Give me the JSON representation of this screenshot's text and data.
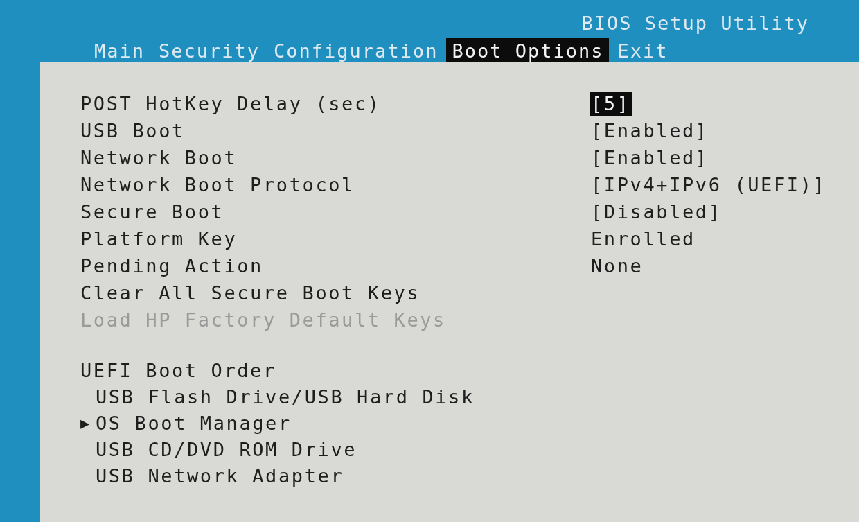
{
  "title": "BIOS Setup Utility",
  "tabs": [
    {
      "label": "Main",
      "selected": false
    },
    {
      "label": "Security",
      "selected": false
    },
    {
      "label": "Configuration",
      "selected": false
    },
    {
      "label": "Boot Options",
      "selected": true
    },
    {
      "label": "Exit",
      "selected": false
    }
  ],
  "settings": [
    {
      "label": "POST HotKey Delay (sec)",
      "value": "[5]",
      "selected": true,
      "disabled": false
    },
    {
      "label": "USB Boot",
      "value": "[Enabled]",
      "selected": false,
      "disabled": false
    },
    {
      "label": "Network Boot",
      "value": "[Enabled]",
      "selected": false,
      "disabled": false
    },
    {
      "label": "Network Boot Protocol",
      "value": "[IPv4+IPv6 (UEFI)]",
      "selected": false,
      "disabled": false
    },
    {
      "label": "Secure Boot",
      "value": "[Disabled]",
      "selected": false,
      "disabled": false
    },
    {
      "label": "Platform Key",
      "value": "Enrolled",
      "selected": false,
      "disabled": false
    },
    {
      "label": "Pending Action",
      "value": "None",
      "selected": false,
      "disabled": false
    },
    {
      "label": "Clear All Secure Boot Keys",
      "selected": false,
      "disabled": false
    },
    {
      "label": "Load HP Factory Default Keys",
      "selected": false,
      "disabled": true
    }
  ],
  "boot_order": {
    "heading": "UEFI Boot Order",
    "pointer": "▶",
    "items": [
      {
        "label": "USB Flash Drive/USB Hard Disk",
        "selected": false
      },
      {
        "label": "OS Boot Manager",
        "selected": true
      },
      {
        "label": "USB CD/DVD ROM Drive",
        "selected": false
      },
      {
        "label": "USB Network Adapter",
        "selected": false
      }
    ]
  }
}
